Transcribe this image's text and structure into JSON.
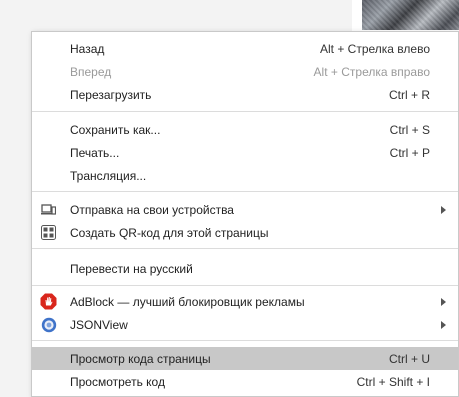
{
  "menu": {
    "items": [
      {
        "label": "Назад",
        "shortcut": "Alt + Стрелка влево",
        "disabled": false
      },
      {
        "label": "Вперед",
        "shortcut": "Alt + Стрелка вправо",
        "disabled": true
      },
      {
        "label": "Перезагрузить",
        "shortcut": "Ctrl + R",
        "disabled": false
      },
      {
        "label": "Сохранить как...",
        "shortcut": "Ctrl + S"
      },
      {
        "label": "Печать...",
        "shortcut": "Ctrl + P"
      },
      {
        "label": "Трансляция..."
      },
      {
        "label": "Отправка на свои устройства",
        "icon": "laptop-phone-icon",
        "submenu": true
      },
      {
        "label": "Создать QR-код для этой страницы",
        "icon": "qr-code-icon"
      },
      {
        "label": "Перевести на русский"
      },
      {
        "label": "AdBlock — лучший блокировщик рекламы",
        "icon": "adblock-hand-icon",
        "submenu": true
      },
      {
        "label": "JSONView",
        "icon": "jsonview-icon",
        "submenu": true
      },
      {
        "label": "Просмотр кода страницы",
        "shortcut": "Ctrl + U",
        "highlighted": true
      },
      {
        "label": "Просмотреть код",
        "shortcut": "Ctrl + Shift + I"
      }
    ]
  },
  "colors": {
    "highlight": "#c8c8c8",
    "disabled_text": "#9a9a9a",
    "adblock_red": "#d9261c",
    "jsonview_blue": "#3f73c9"
  }
}
